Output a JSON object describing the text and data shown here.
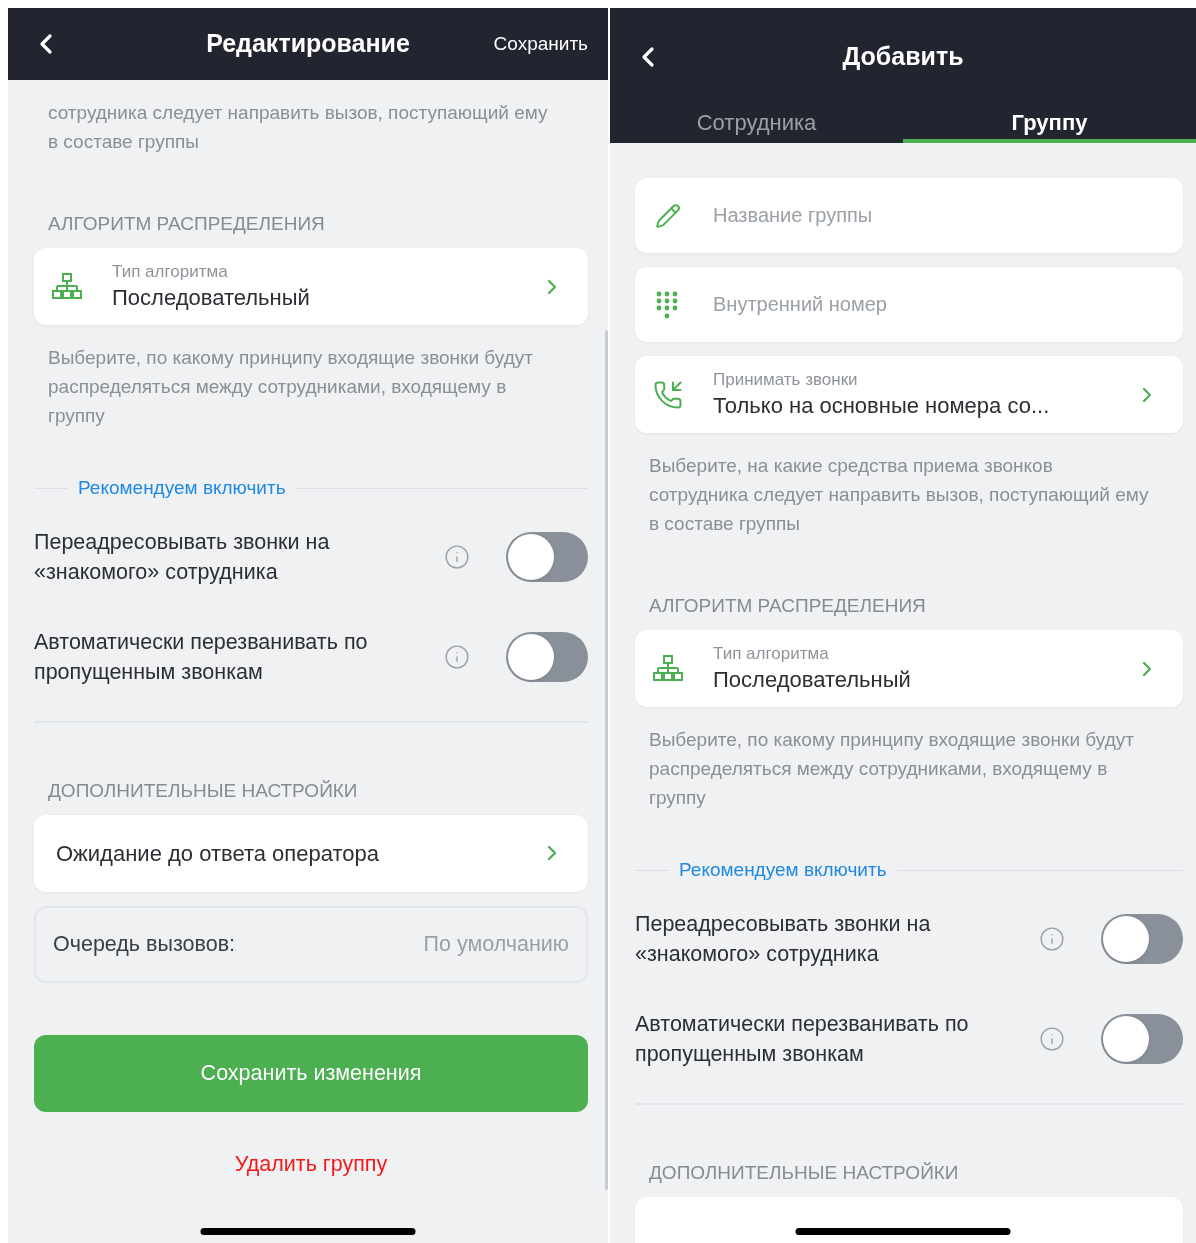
{
  "screens": [
    {
      "header": {
        "title": "Редактирование",
        "action": "Сохранить"
      },
      "blocks": [
        {
          "kind": "note",
          "text": "сотрудника следует направить вызов, поступающий ему в составе группы"
        },
        {
          "kind": "heading",
          "text": "АЛГОРИТМ РАСПРЕДЕЛЕНИЯ"
        },
        {
          "kind": "algorithm_select",
          "label": "Тип алгоритма",
          "value": "Последовательный"
        },
        {
          "kind": "note",
          "text": "Выберите, по какому принципу входящие звонки будут распределяться между сотрудниками, входящему в группу"
        },
        {
          "kind": "recommend",
          "text": "Рекомендуем включить"
        },
        {
          "kind": "toggle",
          "label": "Переадресовывать звонки на «знакомого» сотрудника",
          "on": false
        },
        {
          "kind": "toggle",
          "label": "Автоматически перезванивать по пропущенным звонкам",
          "on": false
        },
        {
          "kind": "divider"
        },
        {
          "kind": "heading",
          "text": "ДОПОЛНИТЕЛЬНЫЕ НАСТРОЙКИ"
        },
        {
          "kind": "link_card",
          "label": "Ожидание до ответа оператора"
        },
        {
          "kind": "value_card",
          "label": "Очередь вызовов:",
          "value": "По умолчанию"
        },
        {
          "kind": "primary_button",
          "label": "Сохранить изменения"
        },
        {
          "kind": "danger_link",
          "label": "Удалить группу"
        }
      ]
    },
    {
      "header": {
        "title": "Добавить"
      },
      "tabs": [
        {
          "label": "Сотрудника",
          "selected": false
        },
        {
          "label": "Группу",
          "selected": true
        }
      ],
      "blocks": [
        {
          "kind": "name_field",
          "placeholder": "Название группы"
        },
        {
          "kind": "extension_field",
          "placeholder": "Внутренний номер"
        },
        {
          "kind": "calls_select",
          "label": "Принимать звонки",
          "value": "Только на основные номера со..."
        },
        {
          "kind": "note",
          "text": "Выберите, на какие средства приема звонков сотрудника следует направить вызов, поступающий ему в составе группы"
        },
        {
          "kind": "heading",
          "text": "АЛГОРИТМ РАСПРЕДЕЛЕНИЯ"
        },
        {
          "kind": "algorithm_select",
          "label": "Тип алгоритма",
          "value": "Последовательный"
        },
        {
          "kind": "note",
          "text": "Выберите, по какому принципу входящие звонки будут распределяться между сотрудниками, входящему в группу"
        },
        {
          "kind": "recommend",
          "text": "Рекомендуем включить"
        },
        {
          "kind": "toggle",
          "label": "Переадресовывать звонки на «знакомого» сотрудника",
          "on": false
        },
        {
          "kind": "toggle",
          "label": "Автоматически перезванивать по пропущенным звонкам",
          "on": false
        },
        {
          "kind": "divider"
        },
        {
          "kind": "heading",
          "text": "ДОПОЛНИТЕЛЬНЫЕ НАСТРОЙКИ"
        },
        {
          "kind": "cut_card"
        }
      ]
    }
  ]
}
